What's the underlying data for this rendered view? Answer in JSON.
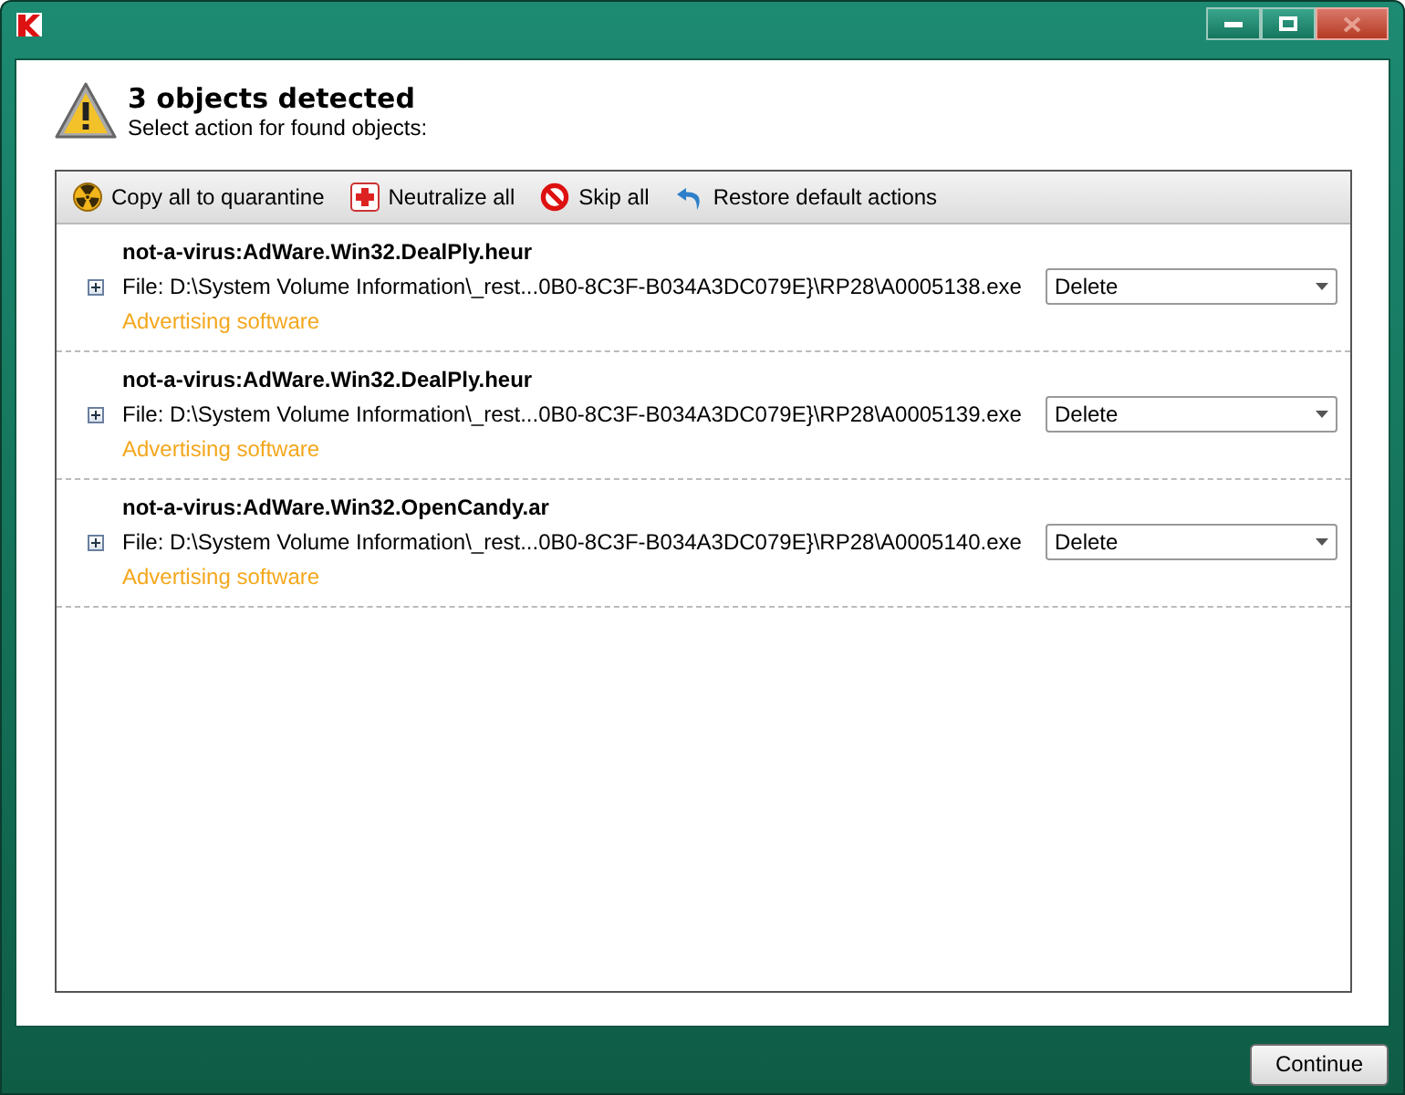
{
  "header": {
    "title": "3 objects detected",
    "subtitle": "Select action for found objects:"
  },
  "toolbar": [
    "Copy all to quarantine",
    "Neutralize all",
    "Skip all",
    "Restore default actions"
  ],
  "objects": [
    {
      "name": "not-a-virus:AdWare.Win32.DealPly.heur",
      "file": "File: D:\\System Volume Information\\_rest...0B0-8C3F-B034A3DC079E}\\RP28\\A0005138.exe",
      "category": "Advertising software",
      "action": "Delete"
    },
    {
      "name": "not-a-virus:AdWare.Win32.DealPly.heur",
      "file": "File: D:\\System Volume Information\\_rest...0B0-8C3F-B034A3DC079E}\\RP28\\A0005139.exe",
      "category": "Advertising software",
      "action": "Delete"
    },
    {
      "name": "not-a-virus:AdWare.Win32.OpenCandy.ar",
      "file": "File: D:\\System Volume Information\\_rest...0B0-8C3F-B034A3DC079E}\\RP28\\A0005140.exe",
      "category": "Advertising software",
      "action": "Delete"
    }
  ],
  "buttons": [
    "Continue"
  ]
}
